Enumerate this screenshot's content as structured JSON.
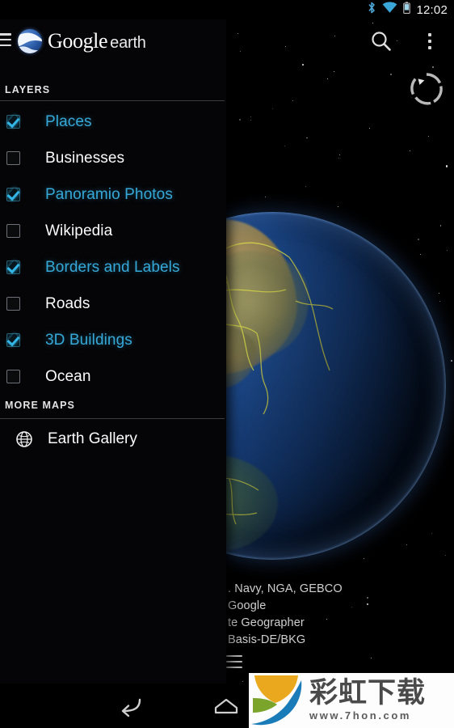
{
  "status_bar": {
    "clock": "12:02",
    "icons": [
      "bluetooth-icon",
      "wifi-icon",
      "battery-icon"
    ]
  },
  "action_bar": {
    "search_icon": "search-icon",
    "overflow_icon": "overflow-menu-icon",
    "compass_icon": "compass-icon"
  },
  "drawer": {
    "menu_icon": "hamburger-menu-icon",
    "brand": {
      "logo_icon": "google-earth-globe-icon",
      "primary": "Google",
      "secondary": "earth"
    },
    "layers_section_label": "LAYERS",
    "layers": [
      {
        "label": "Places",
        "checked": true
      },
      {
        "label": "Businesses",
        "checked": false
      },
      {
        "label": "Panoramio Photos",
        "checked": true
      },
      {
        "label": "Wikipedia",
        "checked": false
      },
      {
        "label": "Borders and Labels",
        "checked": true
      },
      {
        "label": "Roads",
        "checked": false
      },
      {
        "label": "3D Buildings",
        "checked": true
      },
      {
        "label": "Ocean",
        "checked": false
      }
    ],
    "more_maps_section_label": "MORE MAPS",
    "more_maps": [
      {
        "label": "Earth Gallery",
        "icon": "globe-icon"
      }
    ]
  },
  "map": {
    "attribution_lines": [
      ". Navy, NGA, GEBCO",
      " Google",
      "te Geographer",
      "Basis-DE/BKG"
    ],
    "attribution_menu_icon": "attribution-menu-icon"
  },
  "nav_bar": {
    "back_icon": "back-icon",
    "home_icon": "home-icon"
  },
  "watermark": {
    "logo_icon": "caihong-logo-icon",
    "title": "彩虹下载",
    "url": "www.7hon.com"
  },
  "colors": {
    "accent_cyan": "#36a8d8",
    "checkbox_check": "#33b5e5",
    "drawer_bg": "#050507",
    "text_primary": "#fbfbfb",
    "watermark_orange": "#e9a81e",
    "watermark_green": "#7aa42a",
    "watermark_blue": "#1a7bb9"
  }
}
